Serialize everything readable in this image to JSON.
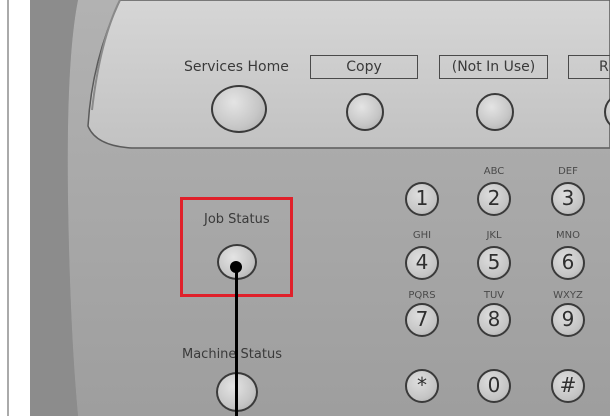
{
  "panel": {
    "colors": {
      "background": "#ffffff",
      "panel_body": "#a7a7a7",
      "bezel_outer": "#7b7b7b",
      "upper_strip": "#c9c9c9",
      "highlight": "#e0202a",
      "pointer": "#000000"
    },
    "buttons": {
      "services_home": {
        "label": "Services Home",
        "icon": "round-button"
      },
      "copy": {
        "label": "Copy",
        "icon": "round-button"
      },
      "not_in_use": {
        "label": "(Not In Use)",
        "icon": "round-button"
      },
      "partial_r": {
        "label": "R"
      },
      "job_status": {
        "label": "Job Status",
        "icon": "round-button"
      },
      "machine_status": {
        "label": "Machine Status",
        "icon": "round-button"
      }
    },
    "keypad": [
      {
        "key": "1",
        "letters": ""
      },
      {
        "key": "2",
        "letters": "ABC"
      },
      {
        "key": "3",
        "letters": "DEF"
      },
      {
        "key": "4",
        "letters": "GHI"
      },
      {
        "key": "5",
        "letters": "JKL"
      },
      {
        "key": "6",
        "letters": "MNO"
      },
      {
        "key": "7",
        "letters": "PQRS"
      },
      {
        "key": "8",
        "letters": "TUV"
      },
      {
        "key": "9",
        "letters": "WXYZ"
      },
      {
        "key": "*",
        "letters": ""
      },
      {
        "key": "0",
        "letters": ""
      },
      {
        "key": "#",
        "letters": ""
      }
    ]
  }
}
